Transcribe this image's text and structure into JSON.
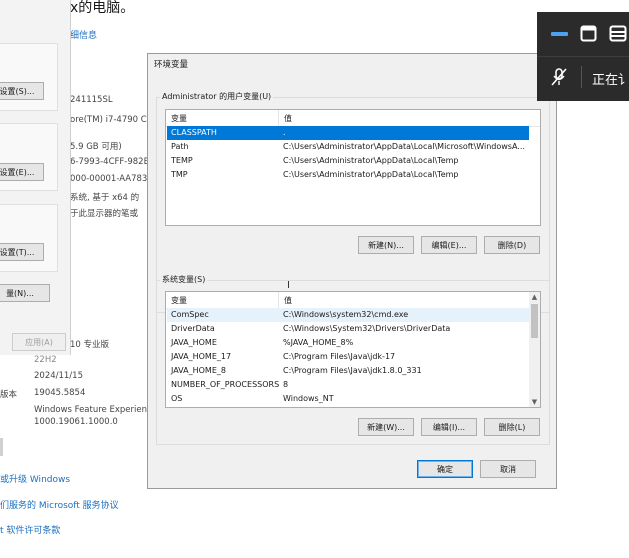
{
  "background": {
    "title_fragment": "х的电脑。",
    "link_info": "细信息",
    "product_id_fragment": "241115SL",
    "processor_fragment": "ore(TM) i7-4790 CF",
    "ram_fragment": "5.9 GB 可用)",
    "device_id_fragment": "6-7993-4CFF-982B",
    "product_id2_fragment": "000-00001-AA783",
    "system_type_fragment": "系统, 基于 x64 的",
    "pen_fragment": "于此显示器的笔或",
    "edition_fragment": "10 专业版",
    "version_fragment": "22H2",
    "install_date": "2024/11/15",
    "build_label_fragment": "版本",
    "build_value": "19045.5854",
    "experience_label": "Windows Feature Experienc",
    "experience_value": "1000.19061.1000.0",
    "link_upgrade": "或升级 Windows",
    "link_service": "们服务的 Microsoft 服务协议",
    "link_license": "t 软件许可条款"
  },
  "left_dialog": {
    "buttons": [
      "设置(S)...",
      "设置(E)...",
      "设置(T)...",
      "量(N)...",
      "应用(A)"
    ]
  },
  "env_dialog": {
    "title": "环境变量",
    "user_section_label": "Administrator 的用户变量(U)",
    "columns": [
      "变量",
      "值"
    ],
    "user_vars": [
      {
        "name": "CLASSPATH",
        "value": ".",
        "selected": true
      },
      {
        "name": "Path",
        "value": "C:\\Users\\Administrator\\AppData\\Local\\Microsoft\\WindowsA..."
      },
      {
        "name": "TEMP",
        "value": "C:\\Users\\Administrator\\AppData\\Local\\Temp"
      },
      {
        "name": "TMP",
        "value": "C:\\Users\\Administrator\\AppData\\Local\\Temp"
      }
    ],
    "user_buttons": {
      "new": "新建(N)...",
      "edit": "编辑(E)...",
      "delete": "删除(D)"
    },
    "system_section_label": "系统变量(S)",
    "system_vars": [
      {
        "name": "ComSpec",
        "value": "C:\\Windows\\system32\\cmd.exe",
        "hover": true
      },
      {
        "name": "DriverData",
        "value": "C:\\Windows\\System32\\Drivers\\DriverData"
      },
      {
        "name": "JAVA_HOME",
        "value": "%JAVA_HOME_8%"
      },
      {
        "name": "JAVA_HOME_17",
        "value": "C:\\Program Files\\Java\\jdk-17"
      },
      {
        "name": "JAVA_HOME_8",
        "value": "C:\\Program Files\\Java\\jdk1.8.0_331"
      },
      {
        "name": "NUMBER_OF_PROCESSORS",
        "value": "8"
      },
      {
        "name": "OS",
        "value": "Windows_NT"
      }
    ],
    "system_buttons": {
      "new": "新建(W)...",
      "edit": "编辑(I)...",
      "delete": "删除(L)"
    },
    "ok": "确定",
    "cancel": "取消"
  },
  "flyout": {
    "status_text": "正在讠",
    "accent": "#4aa3f0"
  }
}
